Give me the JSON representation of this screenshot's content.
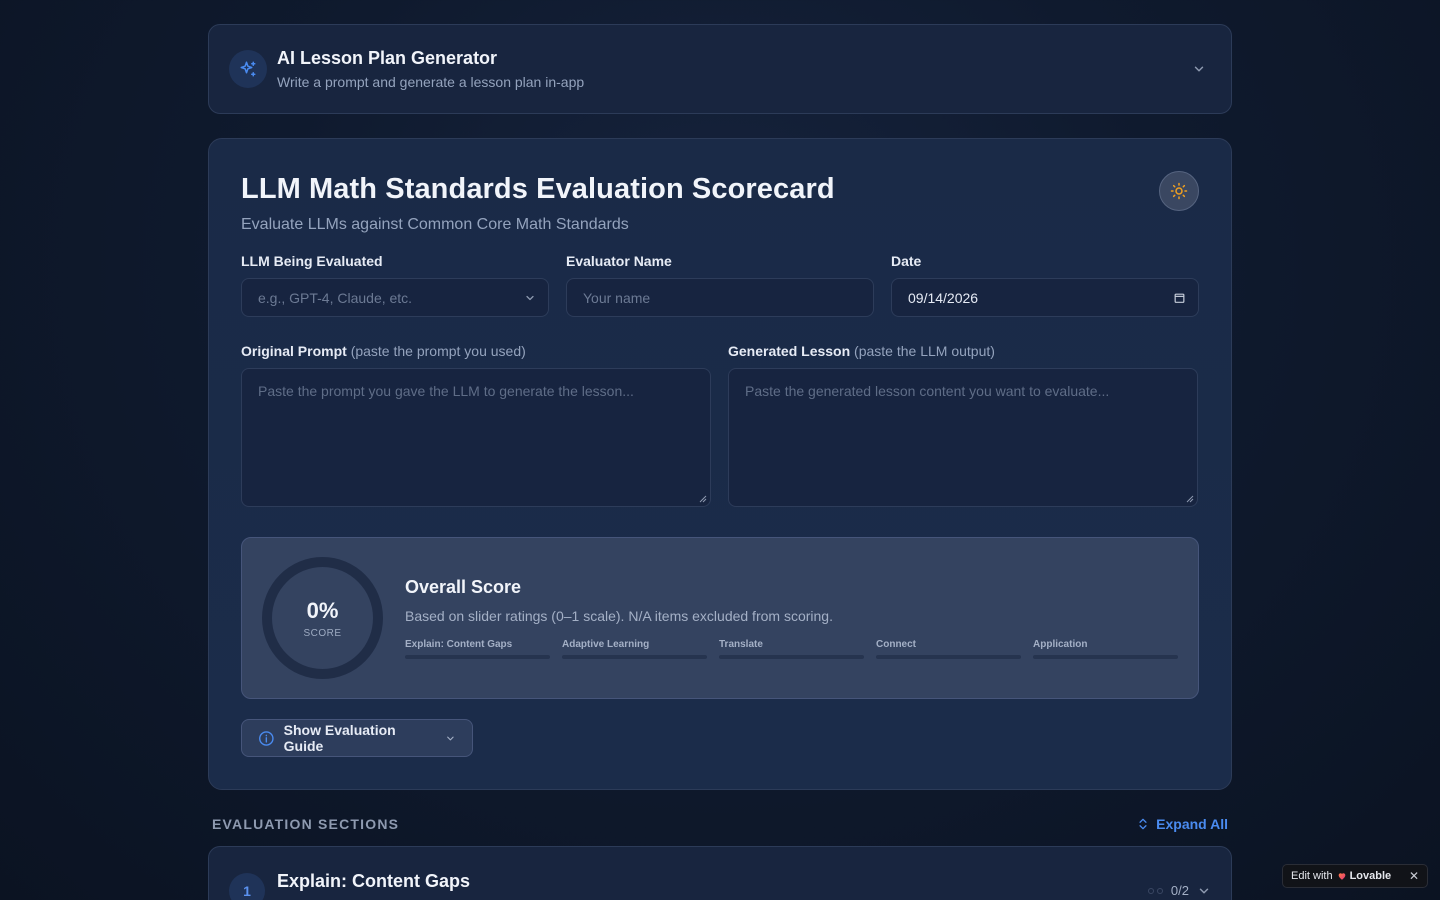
{
  "generator": {
    "title": "AI Lesson Plan Generator",
    "subtitle": "Write a prompt and generate a lesson plan in-app",
    "icon": "sparkles-icon"
  },
  "scorecard": {
    "title": "LLM Math Standards Evaluation Scorecard",
    "subtitle": "Evaluate LLMs against Common Core Math Standards",
    "fields": {
      "llm": {
        "label": "LLM Being Evaluated",
        "placeholder": "e.g., GPT-4, Claude, etc."
      },
      "evaluator": {
        "label": "Evaluator Name",
        "placeholder": "Your name"
      },
      "date": {
        "label": "Date",
        "value": "09/14/2026"
      }
    },
    "prompt": {
      "label": "Original Prompt",
      "hint": "(paste the prompt you used)",
      "placeholder": "Paste the prompt you gave the LLM to generate the lesson..."
    },
    "lesson": {
      "label": "Generated Lesson",
      "hint": "(paste the LLM output)",
      "placeholder": "Paste the generated lesson content you want to evaluate..."
    },
    "overall": {
      "percent": "0%",
      "ring_label": "SCORE",
      "title": "Overall Score",
      "description": "Based on slider ratings (0–1 scale). N/A items excluded from scoring.",
      "bars": [
        {
          "label": "Explain: Content Gaps",
          "value": 0
        },
        {
          "label": "Adaptive Learning",
          "value": 0
        },
        {
          "label": "Translate",
          "value": 0
        },
        {
          "label": "Connect",
          "value": 0
        },
        {
          "label": "Application",
          "value": 0
        }
      ]
    },
    "guide_button": "Show Evaluation Guide"
  },
  "sections": {
    "heading": "EVALUATION SECTIONS",
    "expand_all": "Expand All",
    "items": [
      {
        "number": "1",
        "title": "Explain: Content Gaps",
        "count": "0/2"
      }
    ]
  },
  "badge": {
    "prefix": "Edit with",
    "brand": "Lovable",
    "close": "✕"
  },
  "colors": {
    "accent": "#4a8bf0",
    "sun": "#f0a020",
    "background": "#0f1a2e"
  }
}
